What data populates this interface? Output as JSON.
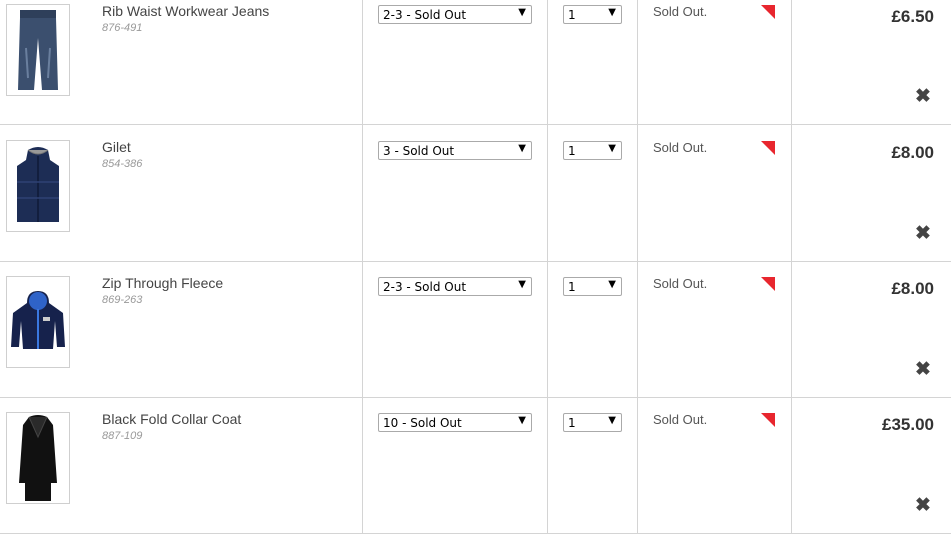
{
  "items": [
    {
      "name": "Rib Waist Workwear Jeans",
      "code": "876-491",
      "size": "2-3 - Sold Out",
      "qty": "1",
      "status": "Sold Out.",
      "price": "£6.50"
    },
    {
      "name": "Gilet",
      "code": "854-386",
      "size": "3 - Sold Out",
      "qty": "1",
      "status": "Sold Out.",
      "price": "£8.00"
    },
    {
      "name": "Zip Through Fleece",
      "code": "869-263",
      "size": "2-3 - Sold Out",
      "qty": "1",
      "status": "Sold Out.",
      "price": "£8.00"
    },
    {
      "name": "Black Fold Collar Coat",
      "code": "887-109",
      "size": "10 - Sold Out",
      "qty": "1",
      "status": "Sold Out.",
      "price": "£35.00"
    }
  ],
  "icons": {
    "remove": "close-icon",
    "dropdown": "triangle-down-icon",
    "sold_out_flag": "red-corner-flag"
  },
  "colors": {
    "flag": "#e8262e",
    "border": "#d4d4d4"
  }
}
